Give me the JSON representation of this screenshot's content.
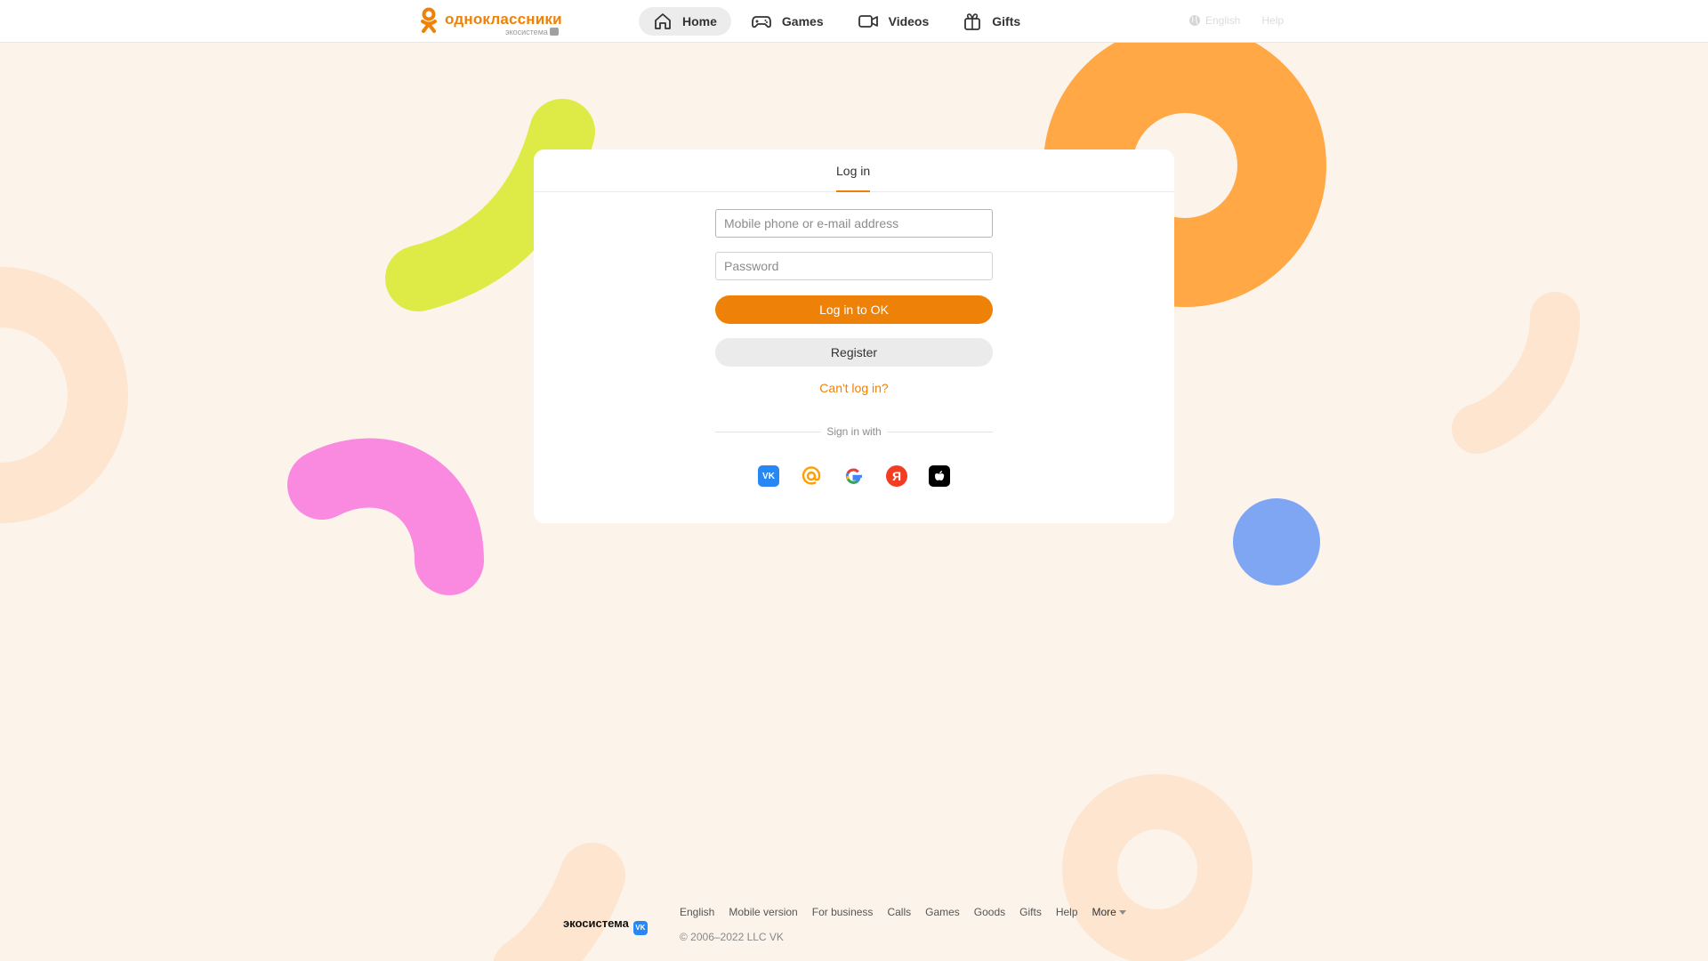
{
  "header": {
    "logo_text": "одноклассники",
    "logo_sub": "экосистема",
    "nav": [
      {
        "label": "Home"
      },
      {
        "label": "Games"
      },
      {
        "label": "Videos"
      },
      {
        "label": "Gifts"
      }
    ],
    "language": "English",
    "help": "Help"
  },
  "login": {
    "tab_label": "Log in",
    "login_placeholder": "Mobile phone or e-mail address",
    "password_placeholder": "Password",
    "submit_label": "Log in to OK",
    "register_label": "Register",
    "cant_login": "Can't log in?",
    "sign_in_with": "Sign in with",
    "providers": [
      "VK",
      "Mail.ru",
      "Google",
      "Yandex",
      "Apple"
    ]
  },
  "footer": {
    "ecosystem": "экосистема",
    "links": [
      "English",
      "Mobile version",
      "For business",
      "Calls",
      "Games",
      "Goods",
      "Gifts",
      "Help"
    ],
    "more": "More",
    "copyright": "© 2006–2022 LLC VK"
  },
  "colors": {
    "brand": "#ee8208",
    "background": "#fcf3eb",
    "blob_lime": "#deeb47",
    "blob_orange": "#ffa845",
    "blob_pink": "#fa89e0",
    "blob_blue": "#7ea6f2",
    "blob_pale": "#fde5cf"
  }
}
